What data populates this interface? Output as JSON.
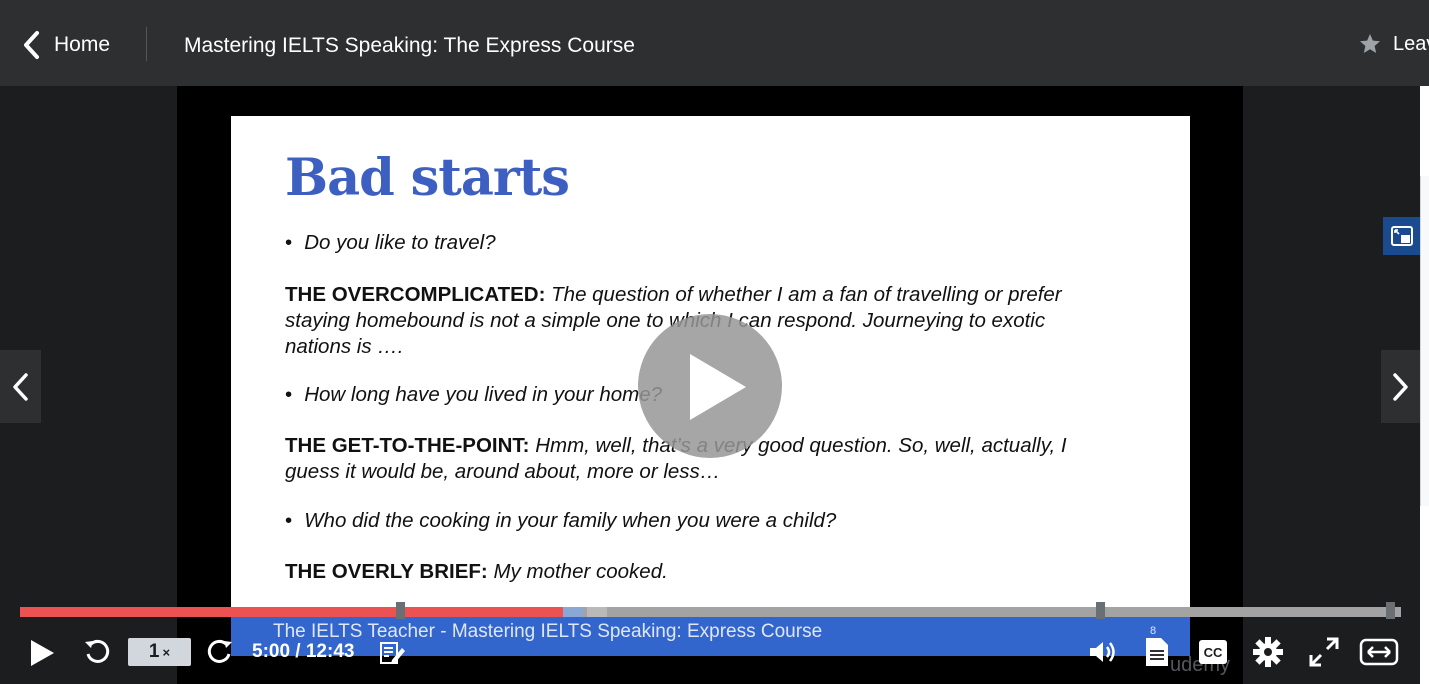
{
  "header": {
    "home_label": "Home",
    "course_title": "Mastering IELTS Speaking: The Express Course",
    "leave_rating_label": "Leav"
  },
  "slide": {
    "title": "Bad starts",
    "q1": "Do you like to travel?",
    "a1_label": "THE OVERCOMPLICATED:",
    "a1_text": "The question of whether I am a fan of travelling or prefer staying homebound is not a simple one to which I can respond. Journeying to exotic nations is ….",
    "q2": "How long have you lived in your home?",
    "a2_label": "THE GET-TO-THE-POINT:",
    "a2_text": "Hmm, well, that’s a very good question. So, well, actually, I guess it would be, around about, more or less…",
    "q3": "Who did the cooking in your family when you were a child?",
    "a3_label": "THE OVERLY BRIEF:",
    "a3_text": "My mother cooked.",
    "footer_author": "The IELTS Teacher",
    "footer_sep": " - ",
    "footer_course": "Mastering IELTS Speaking: Express Course",
    "page_number": "8",
    "watermark": "udemy"
  },
  "player": {
    "speed_value": "1",
    "speed_suffix": "×",
    "time_display": "5:00 / 12:43",
    "progress_played_fraction": 0.393,
    "progress_buffered_fraction": 0.408,
    "bookmarks_fraction": [
      0.275,
      0.782,
      0.992
    ]
  },
  "icons": {
    "back": "chevron-left-icon",
    "star": "star-icon",
    "big_play": "play-icon",
    "prev": "chevron-left-icon",
    "next": "chevron-right-icon",
    "pip": "picture-in-picture-icon",
    "play": "play-icon",
    "rewind": "rewind-icon",
    "forward": "forward-icon",
    "notes": "note-icon",
    "volume": "volume-icon",
    "transcript": "transcript-icon",
    "captions": "captions-icon",
    "settings": "gear-icon",
    "fullscreen": "fullscreen-icon",
    "expand": "expand-icon"
  },
  "colors": {
    "accent_red": "#ec5252",
    "slide_title_blue": "#3d5fc2",
    "band_blue": "#3366cc",
    "topbar": "#2d2f31"
  }
}
